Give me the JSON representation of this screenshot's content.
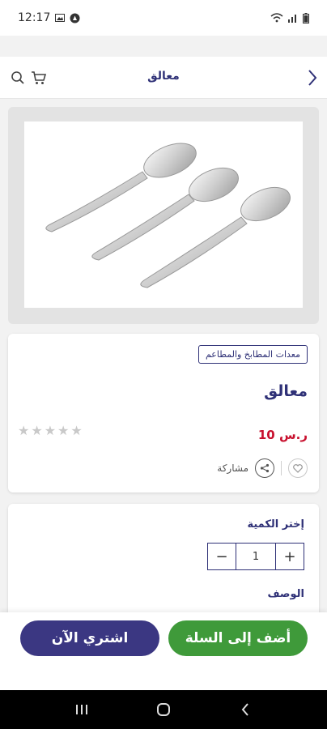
{
  "status": {
    "time": "12:17"
  },
  "header": {
    "title": "معالق"
  },
  "product": {
    "category": "معدات المطابخ والمطاعم",
    "name": "معالق",
    "price": "10 ر.س",
    "rating": 0,
    "share_label": "مشاركة"
  },
  "quantity": {
    "label": "إختر الكمية",
    "value": "1",
    "minus": "−",
    "plus": "+"
  },
  "description": {
    "label": "الوصف"
  },
  "buttons": {
    "add_to_cart": "أضف إلى السلة",
    "buy_now": "اشتري الآن"
  },
  "colors": {
    "brand": "#2f3177",
    "price": "#c8102e",
    "add_cart": "#3f9a3a",
    "buy_now": "#3b3782"
  }
}
